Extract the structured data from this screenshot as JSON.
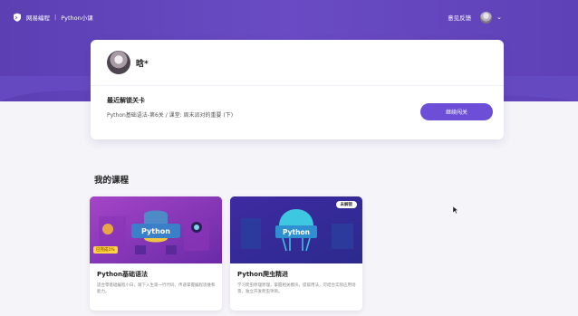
{
  "header": {
    "brand": "网易编程",
    "separator": "|",
    "crumb": "Python小课",
    "feedback": "意见反馈",
    "menu_icon": "chevron-down-icon"
  },
  "user": {
    "name": "晗*"
  },
  "recent": {
    "title": "最近解锁关卡",
    "subtitle": "Python基础语法-第6关 / 课堂: 周末派对的重要 (下)",
    "button": "继续闯关"
  },
  "courses_title": "我的课程",
  "courses": [
    {
      "name": "Python基础语法",
      "desc": "适合零基础编程小白，踏下入生第一行代码，传递掌握编程思维和能力。",
      "thumb_label": "Python",
      "progress_tag": "已完成1%",
      "progress": 0.01
    },
    {
      "name": "Python爬虫精进",
      "desc": "学习爬虫原理原理，掌握相关模块，提取用法，可结合实际应用场景，独立开发爬虫项目。",
      "thumb_label": "Python",
      "badge": "未解锁"
    }
  ],
  "colors": {
    "hero": "#6a4bc4",
    "accent": "#6c4fd6"
  }
}
